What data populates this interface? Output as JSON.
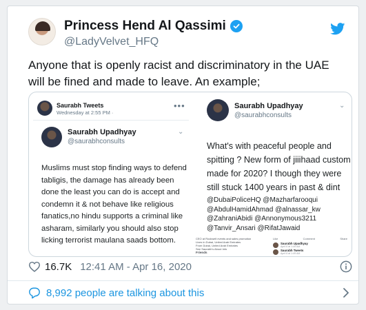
{
  "author": {
    "name": "Princess Hend Al Qassimi",
    "handle": "@LadyVelvet_HFQ"
  },
  "tweet": {
    "text": "Anyone that is openly racist and discriminatory in the UAE will be fined and made to leave. An example;"
  },
  "left_screenshot": {
    "top_name": "Saurabh Tweets",
    "top_time": "Wednesday at 2:55 PM · ",
    "name": "Saurabh Upadhyay",
    "handle": "@saurabhconsults",
    "body": "Muslims must stop finding ways to defend tabligis, the damage has already been done the least you can do is accept and condemn it & not behave like religious fanatics,no hindu supports a criminal like asharam, similarly you should also stop licking terrorist maulana saads bottom."
  },
  "right_screenshot": {
    "name": "Saurabh Upadhyay",
    "handle": "@saurabhconsults",
    "body": "What's with peaceful people and spitting ? New form of jiiihaad custom made for 2020? I though they were still stuck 1400 years in past & dint",
    "mentions": [
      "@DubaiPoliceHQ @Mazharfarooqui",
      "@AbdulHamidAhmad @alnassar_kw",
      "@ZahraniAbidi @Annonymous3211",
      "@Tanvir_Ansari @RifatJawaid"
    ],
    "profile_lines": [
      "CEO at Rockwell events and sales promotion",
      "Lives in Dubai, United Arab Emirates",
      "From Dubai, United Arab Emirates",
      "See Saurabh's About Info"
    ],
    "friends_label": "Friends",
    "post_card_1": "Saurabh Upadhyay",
    "post_card_1_time": "April 6 at 1:49 AM",
    "post_card_2": "Saurabh Tweets",
    "post_card_2_time": "April 6 at 1:49 AM",
    "actions": [
      "Like",
      "Comment",
      "Share"
    ]
  },
  "stats": {
    "likes": "16.7K",
    "timestamp": "12:41 AM - Apr 16, 2020"
  },
  "footer": {
    "talking": "8,992 people are talking about this"
  },
  "colors": {
    "accent": "#1da1f2",
    "link": "#1b95e0",
    "text": "#14171a",
    "muted": "#657786"
  },
  "icons": [
    "verified-badge-icon",
    "twitter-bird-icon",
    "heart-icon",
    "info-icon",
    "speech-bubble-icon",
    "chevron-right-icon"
  ]
}
